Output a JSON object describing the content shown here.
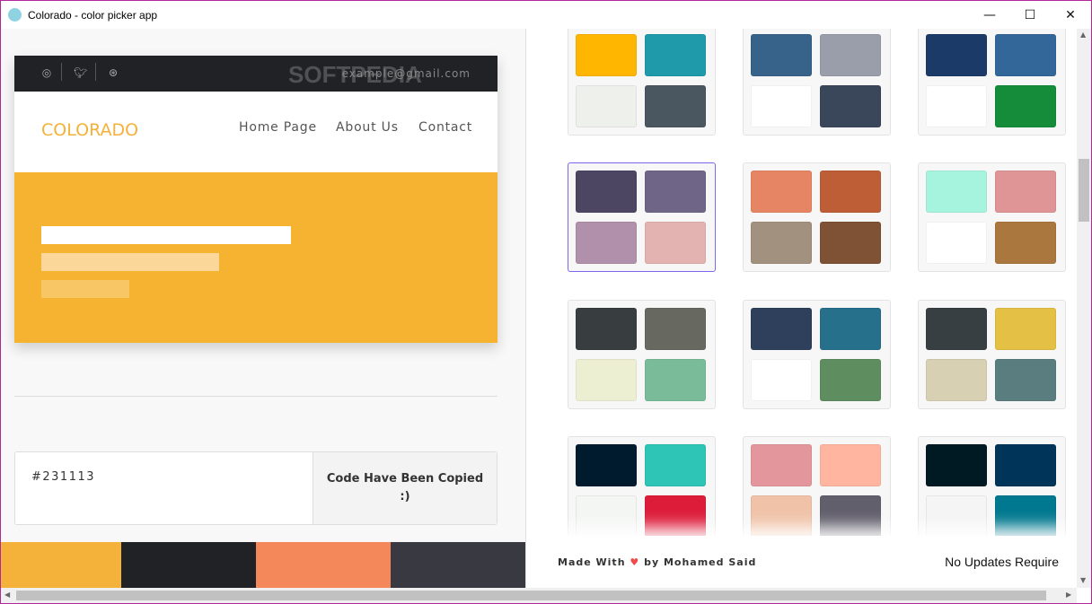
{
  "window": {
    "title": "Colorado - color picker app",
    "min": "—",
    "max": "☐",
    "close": "✕"
  },
  "preview": {
    "social": [
      "instagram-icon",
      "twitter-icon",
      "dribbble-icon"
    ],
    "email": "example@gmail.com",
    "watermark": "SOFTPEDIA",
    "logo": "COLORADO",
    "nav": [
      "Home Page",
      "About Us",
      "Contact"
    ],
    "hero_color": "#F5B331"
  },
  "code": {
    "value": "#231113",
    "status": "Code Have Been Copied :)"
  },
  "strip": [
    "#F4B23A",
    "#212226",
    "#F5885A",
    "#393A41"
  ],
  "palettes": [
    [
      "#FFB600",
      "#1E9AAB",
      "#EEF0EC",
      "#4A5660"
    ],
    [
      "#37628A",
      "#9A9DAA",
      "#FFFFFF",
      "#3A4659"
    ],
    [
      "#1B3A67",
      "#336699",
      "#FFFFFF",
      "#148C3A"
    ],
    [
      "#4D4663",
      "#6E6587",
      "#B090AB",
      "#E2B3B0"
    ],
    [
      "#E68563",
      "#BD5E36",
      "#A39180",
      "#7F5235"
    ],
    [
      "#A6F4DE",
      "#DF9496",
      "#FFFFFF",
      "#AA773F"
    ],
    [
      "#383D40",
      "#676860",
      "#EDEFD2",
      "#7ABB9A"
    ],
    [
      "#2E405C",
      "#27708C",
      "#FFFFFF",
      "#5E8E60"
    ],
    [
      "#383F42",
      "#E4C044",
      "#D8D0B3",
      "#5A7E7F"
    ],
    [
      "#001B2E",
      "#2EC4B6",
      "#F4F6F4",
      "#DD1C3A"
    ],
    [
      "#E3979C",
      "#FFB5A0",
      "#F0C3A8",
      "#625F6C"
    ],
    [
      "#001A23",
      "#003459",
      "#F5F5F5",
      "#00788F"
    ]
  ],
  "selected_palette": 3,
  "footer": {
    "made_with": "Made With",
    "heart": "♥",
    "by": "by Mohamed Said",
    "updates": "No Updates Require"
  }
}
